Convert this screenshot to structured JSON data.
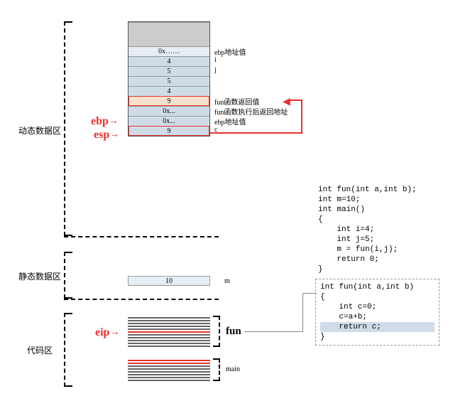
{
  "regions": {
    "dynamic": "动态数据区",
    "static": "静态数据区",
    "code": "代码区"
  },
  "stack": {
    "cells": [
      "0x……",
      "4",
      "5",
      "5",
      "4",
      "9",
      "0x...",
      "0x...",
      "9"
    ],
    "labels": [
      "ebp地址值",
      "i",
      "j",
      "",
      "",
      "fun函数返回值",
      "fun函数执行后返回地址",
      "ebp地址值",
      "c"
    ]
  },
  "static_area": {
    "m_val": "10",
    "m_lbl": "m"
  },
  "pointers": {
    "ebp": "ebp",
    "esp": "esp",
    "eip": "eip"
  },
  "code_labels": {
    "fun": "fun",
    "main": "main"
  },
  "code1": {
    "l1": "int fun(int a,int b);",
    "l2": "int m=10;",
    "l3": "int main()",
    "l4": "{",
    "l5": "    int i=4;",
    "l6": "    int j=5;",
    "l7": "    m = fun(i,j);",
    "l8": "    return 0;",
    "l9": "}"
  },
  "code2": {
    "l1": "int fun(int a,int b)",
    "l2": "{",
    "l3": "    int c=0;",
    "l4": "    c=a+b;",
    "l5": "    return c;",
    "l6": "}"
  }
}
